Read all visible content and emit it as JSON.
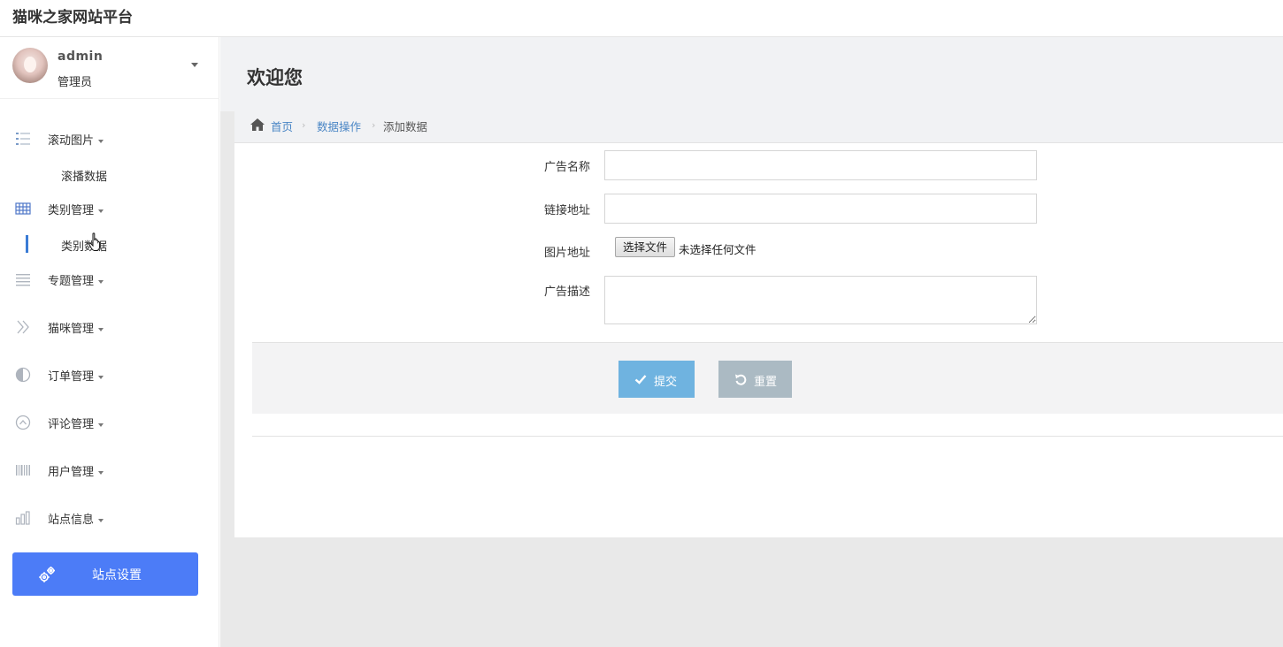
{
  "brand": {
    "title": "猫咪之家网站平台"
  },
  "user": {
    "name": "admin",
    "role": "管理员"
  },
  "sidebar": {
    "items": [
      {
        "label": "滚动图片",
        "icon": "list-icon",
        "sub": [
          "滚播数据"
        ]
      },
      {
        "label": "类别管理",
        "icon": "grid-icon",
        "sub": [
          "类别数据"
        ],
        "active_sub": "类别数据"
      },
      {
        "label": "专题管理",
        "icon": "align-justify-icon"
      },
      {
        "label": "猫咪管理",
        "icon": "double-angle-right-icon"
      },
      {
        "label": "订单管理",
        "icon": "adjust-icon"
      },
      {
        "label": "评论管理",
        "icon": "circle-up-icon"
      },
      {
        "label": "用户管理",
        "icon": "barcode-icon"
      },
      {
        "label": "站点信息",
        "icon": "bar-chart-icon"
      }
    ],
    "settings_label": "站点设置"
  },
  "page": {
    "title": "欢迎您"
  },
  "breadcrumb": {
    "home": "首页",
    "section": "数据操作",
    "current": "添加数据",
    "separator": "›"
  },
  "form": {
    "ad_name_label": "广告名称",
    "ad_name_value": "",
    "link_label": "链接地址",
    "link_value": "",
    "image_label": "图片地址",
    "file_button": "选择文件",
    "file_status": "未选择任何文件",
    "desc_label": "广告描述",
    "desc_value": "",
    "submit_label": "提交",
    "reset_label": "重置"
  },
  "colors": {
    "accent": "#4c7cf7",
    "submit": "#6fb3e0",
    "reset": "#abbac3",
    "link": "#4a86c5"
  }
}
